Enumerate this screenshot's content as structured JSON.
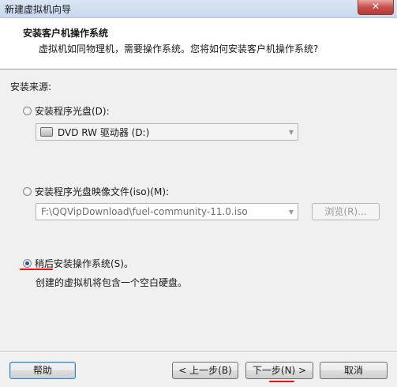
{
  "window": {
    "title": "新建虚拟机向导",
    "close_label": "✕"
  },
  "header": {
    "title": "安装客户机操作系统",
    "subtitle": "虚拟机如同物理机，需要操作系统。您将如何安装客户机操作系统?"
  },
  "source": {
    "label": "安装来源:",
    "disc_option": "安装程序光盘(D):",
    "disc_drive": "DVD RW 驱动器 (D:)",
    "iso_option": "安装程序光盘映像文件(iso)(M):",
    "iso_path": "F:\\QQVipDownload\\fuel-community-11.0.iso",
    "browse_label": "浏览(R)...",
    "later_option": "稍后安装操作系统(S)。",
    "later_desc": "创建的虚拟机将包含一个空白硬盘。",
    "selected": "later"
  },
  "footer": {
    "help": "帮助",
    "back": "< 上一步(B)",
    "next": "下一步(N) >",
    "cancel": "取消"
  },
  "colors": {
    "annotation": "#e11111",
    "radio_selected": "#1f5fa8"
  }
}
